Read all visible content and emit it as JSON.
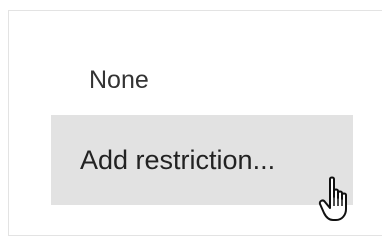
{
  "restriction": {
    "current_value": "None",
    "add_button_label": "Add restriction..."
  },
  "colors": {
    "button_background": "#e2e2e2",
    "panel_border": "#e3e3e3",
    "text": "#333333"
  },
  "icons": {
    "cursor": "hand-pointer-cursor-icon"
  }
}
